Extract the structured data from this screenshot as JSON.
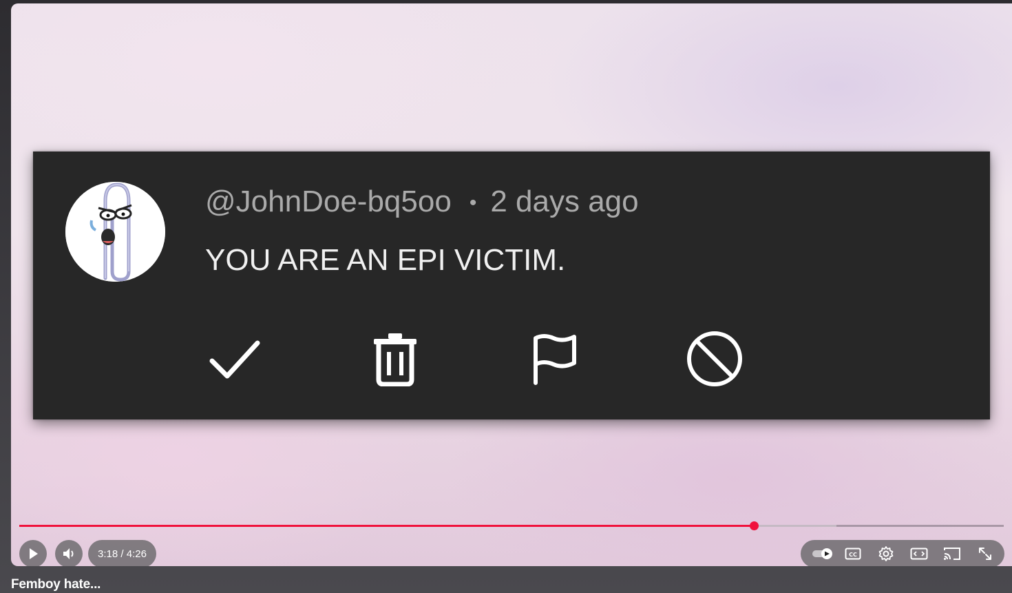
{
  "comment": {
    "username": "@JohnDoe-bq5oo",
    "separator": "•",
    "timestamp": "2 days ago",
    "text": "YOU ARE AN EPI VICTIM."
  },
  "actions": [
    {
      "icon": "checkmark-icon"
    },
    {
      "icon": "trash-icon"
    },
    {
      "icon": "flag-icon"
    },
    {
      "icon": "block-icon"
    }
  ],
  "player": {
    "time_display": "3:18 / 4:26",
    "current_time": "3:18",
    "duration": "4:26",
    "progress_fraction": 0.746,
    "buffered_fraction": 0.83,
    "accent_color": "#f0123c"
  },
  "controls": {
    "left": [
      "play-icon",
      "volume-icon"
    ],
    "right": [
      "autoplay-toggle-icon",
      "captions-icon",
      "settings-icon",
      "miniplayer-icon",
      "cast-icon",
      "fullscreen-icon"
    ]
  },
  "video": {
    "title": "Femboy hate..."
  }
}
